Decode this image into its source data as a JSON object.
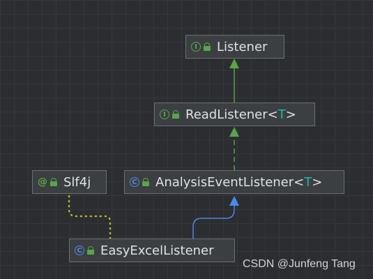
{
  "nodes": {
    "listener": {
      "name": "Listener",
      "kind_glyph": "I"
    },
    "read_listener": {
      "name": "ReadListener<",
      "type_param": "T",
      "close": ">",
      "kind_glyph": "I"
    },
    "analysis_event_listener": {
      "name": "AnalysisEventListener<",
      "type_param": "T",
      "close": ">",
      "kind_glyph": "C"
    },
    "slf4j": {
      "name": "Slf4j",
      "kind_glyph": "@"
    },
    "easy_excel_listener": {
      "name": "EasyExcelListener",
      "kind_glyph": "C"
    }
  },
  "edges": [
    {
      "from": "ReadListener",
      "to": "Listener",
      "type": "extends",
      "style": "solid",
      "color": "#57a64a"
    },
    {
      "from": "AnalysisEventListener",
      "to": "ReadListener",
      "type": "implements",
      "style": "dashed",
      "color": "#57a64a"
    },
    {
      "from": "EasyExcelListener",
      "to": "AnalysisEventListener",
      "type": "extends",
      "style": "solid",
      "color": "#4c8ae8"
    },
    {
      "from": "Slf4j",
      "to": "EasyExcelListener",
      "type": "annotation",
      "style": "dotted",
      "color": "#b5b52b"
    }
  ],
  "watermark": "CSDN @Junfeng Tang"
}
